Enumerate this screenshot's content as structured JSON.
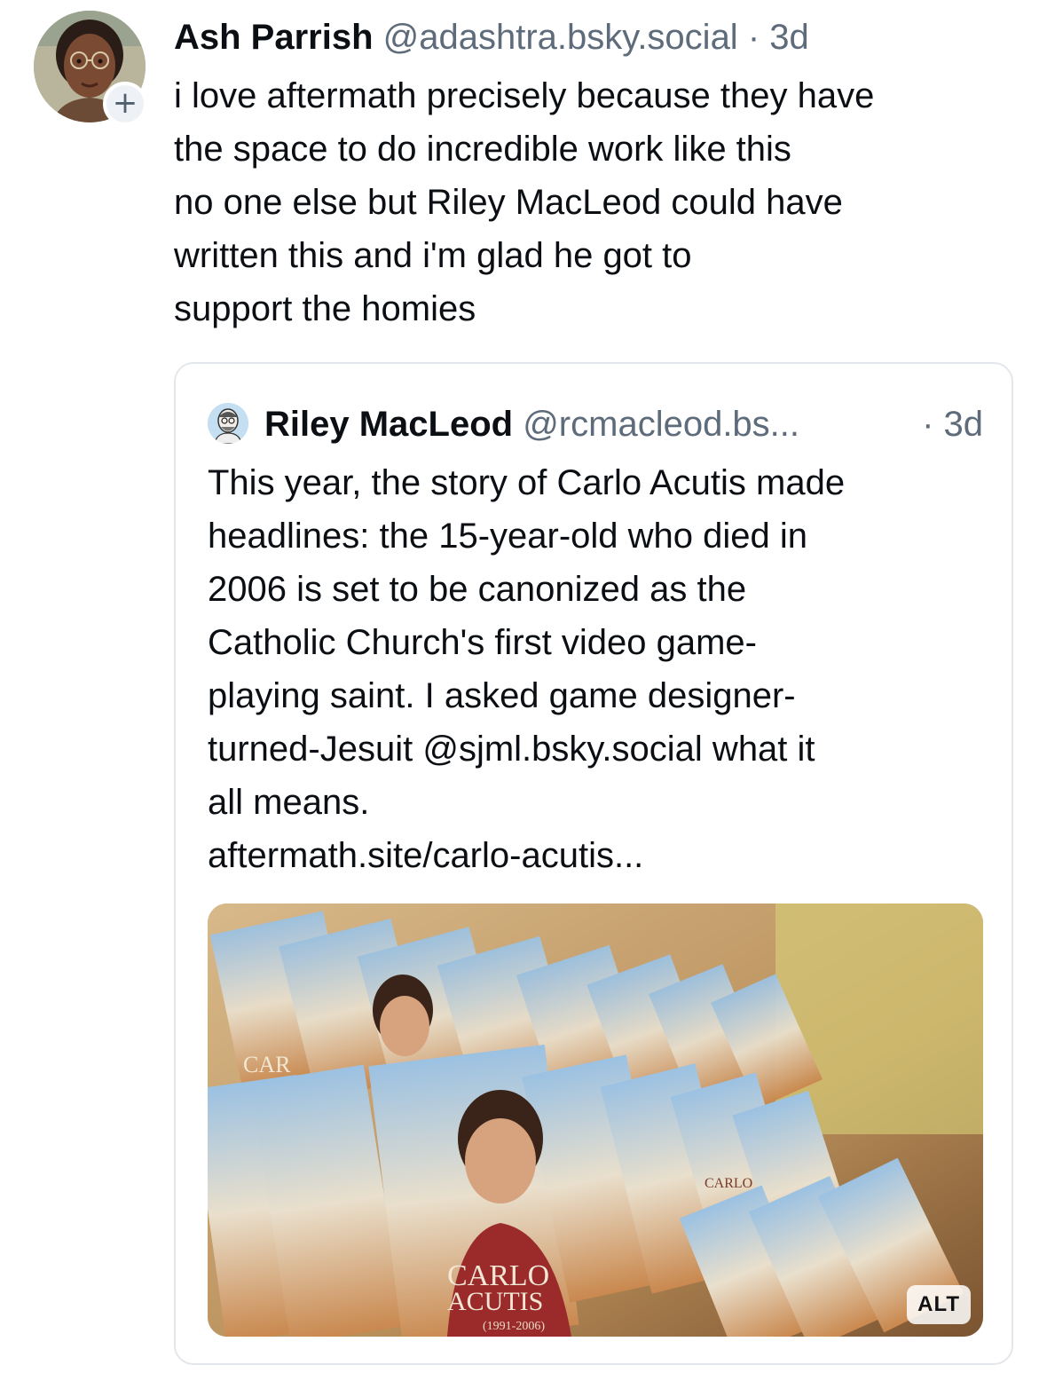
{
  "post": {
    "author_name": "Ash Parrish",
    "author_handle": "@adashtra.bsky.social",
    "separator": "·",
    "time": "3d",
    "follow_label": "+",
    "text_lines": [
      "i love aftermath precisely because they have",
      "the space to do incredible work like this",
      "no one else but Riley MacLeod could have",
      "written this and i'm glad he got to",
      "support the homies"
    ]
  },
  "quote": {
    "author_name": "Riley MacLeod",
    "author_handle": "@rcmacleod.bs...",
    "time": "· 3d",
    "text_lines": [
      "This year, the story of Carlo Acutis made",
      "headlines: the 15-year-old who died in",
      "2006 is set to be canonized as the",
      "Catholic Church's first video game-",
      "playing saint. I asked game designer-",
      "turned-Jesuit @sjml.bsky.social what it",
      "all means.",
      "aftermath.site/carlo-acutis..."
    ],
    "image": {
      "alt_badge": "ALT",
      "card_text_1": "CARLO",
      "card_text_2": "ACUTIS",
      "card_text_3": "(1991-2006)",
      "card_text_4": "CAR",
      "card_text_5": "CARLO"
    }
  }
}
